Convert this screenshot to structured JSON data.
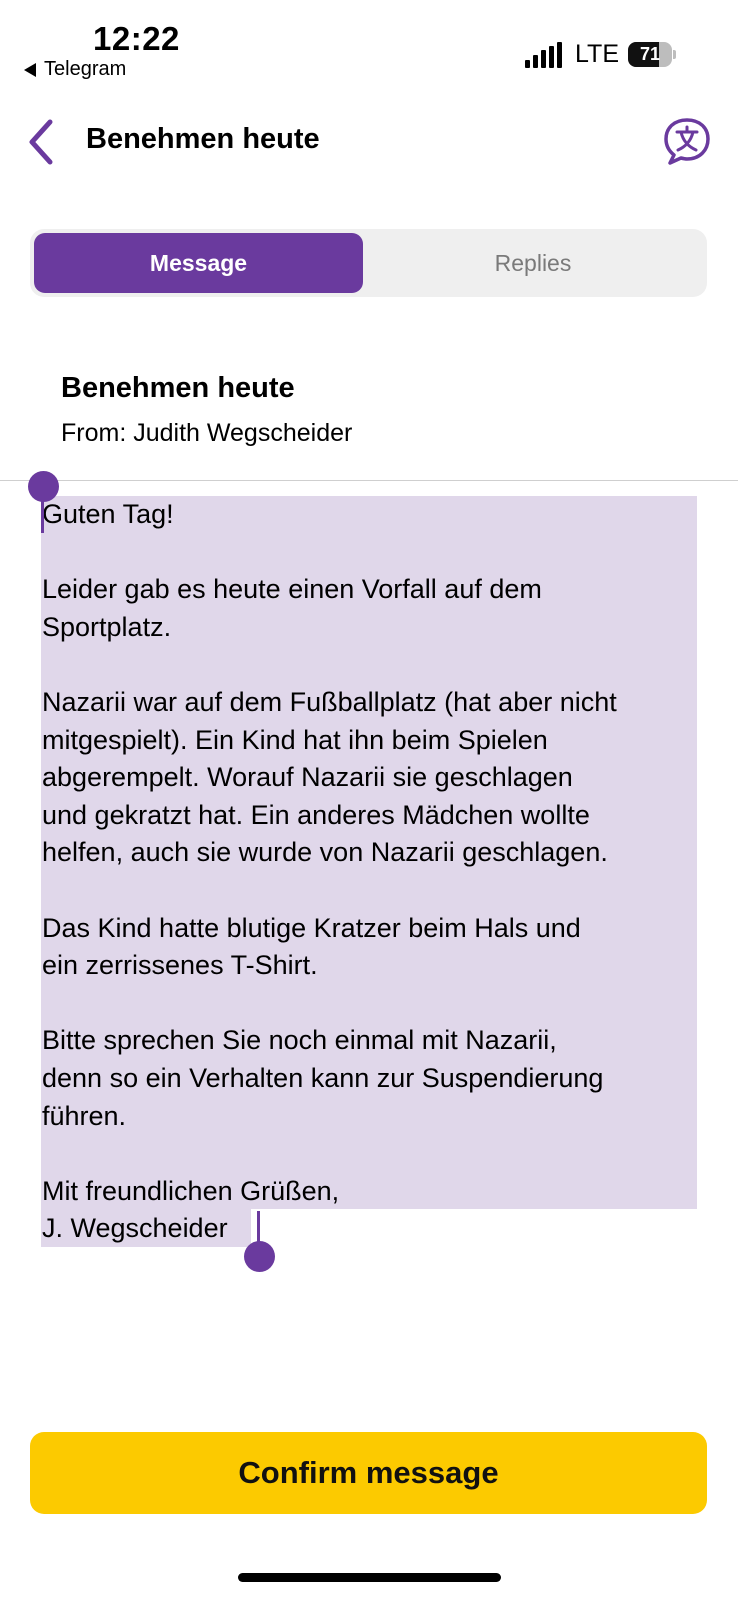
{
  "status_bar": {
    "time": "12:22",
    "back_app": "Telegram",
    "network": "LTE",
    "battery": "71",
    "battery_level": 0.71
  },
  "header": {
    "title": "Benehmen heute",
    "back_icon": "chevron-left-icon",
    "translate_icon": "translate-icon"
  },
  "tabs": [
    {
      "label": "Message",
      "selected": true
    },
    {
      "label": "Replies",
      "selected": false
    }
  ],
  "message": {
    "subject": "Benehmen heute",
    "from": "From: Judith Wegscheider",
    "body": [
      "Guten Tag!",
      "",
      "Leider gab es heute einen Vorfall auf dem",
      "Sportplatz.",
      "",
      "Nazarii war auf dem Fußballplatz (hat aber nicht",
      "mitgespielt). Ein Kind hat ihn beim Spielen",
      "abgerempelt. Worauf Nazarii sie geschlagen",
      "und gekratzt hat. Ein anderes Mädchen wollte",
      "helfen, auch sie wurde von Nazarii geschlagen.",
      "",
      "Das Kind hatte blutige Kratzer beim Hals und",
      "ein zerrissenes T-Shirt.",
      "",
      "Bitte sprechen Sie noch einmal mit Nazarii,",
      "denn so ein Verhalten kann zur Suspendierung",
      "führen.",
      "",
      "Mit freundlichen Grüßen,",
      "J. Wegscheider"
    ]
  },
  "footer": {
    "confirm_label": "Confirm message"
  },
  "colors": {
    "accent": "#6a3a9e",
    "selection": "#e0d7ea",
    "confirm_bg": "#fcca00"
  }
}
